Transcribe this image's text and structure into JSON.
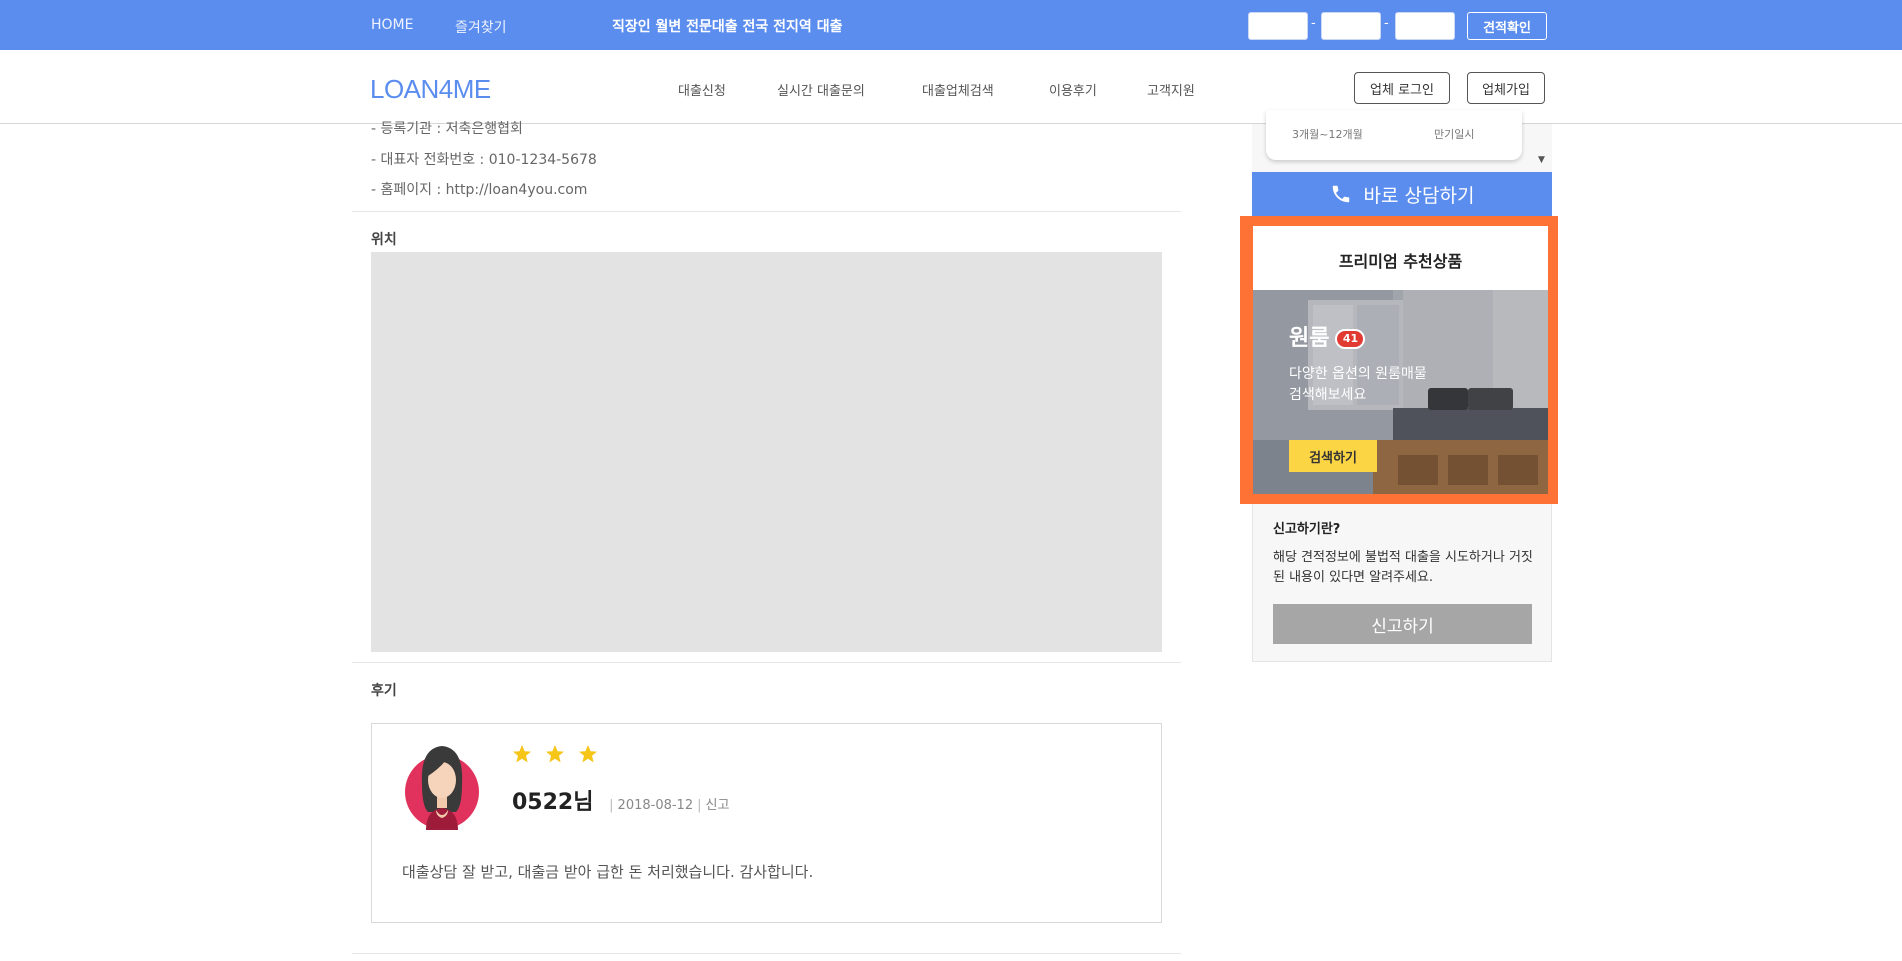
{
  "topbar": {
    "nav": [
      "HOME",
      "즐겨찾기"
    ],
    "promo": "직장인 월변 전문대출 전국 전지역 대출",
    "estimate_button": "견적확인",
    "dash": "-"
  },
  "header": {
    "logo": "LOAN4ME",
    "menu": [
      "대출신청",
      "실시간 대출문의",
      "대출업체검색",
      "이용후기",
      "고객지원"
    ],
    "login_button": "업체 로그인",
    "join_button": "업체가입"
  },
  "company_info": {
    "lines": [
      "- 등록기관 : 저축은행협회",
      "- 대표자 전화번호 : 010-1234-5678",
      "- 홈페이지 : http://loan4you.com"
    ]
  },
  "location": {
    "title": "위치"
  },
  "reviews": {
    "title": "후기",
    "items": [
      {
        "rating": 3,
        "name": "0522님",
        "date": "2018-08-12",
        "report": "신고",
        "text": "대출상담 잘 받고, 대출금 받아 급한 돈 처리했습니다. 감사합니다."
      }
    ]
  },
  "sidebar": {
    "card": {
      "period": "3개월~12개월",
      "repayment": "만기일시"
    },
    "consult_button": "바로 상담하기",
    "premium": {
      "title": "프리미엄 추천상품",
      "room_title": "원룸",
      "badge": "41",
      "desc_line1": "다양한 옵션의 원룸매물",
      "desc_line2": "검색해보세요",
      "search_button": "검색하기"
    },
    "report": {
      "title": "신고하기란?",
      "desc": "해당 견적정보에 불법적 대출을 시도하거나 거짓된 내용이 있다면 알려주세요.",
      "button": "신고하기"
    }
  },
  "colors": {
    "primary": "#5b8def",
    "premium_border": "#ff7236",
    "star": "#f5c518",
    "search_button": "#fcd545",
    "report_button": "#a6a6a6"
  }
}
